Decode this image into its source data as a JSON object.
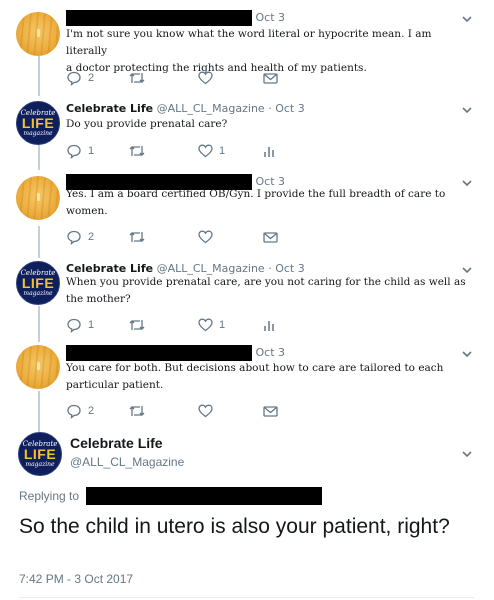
{
  "tweets": [
    {
      "author_name": "",
      "date": "Oct 3",
      "text_lines": [
        "I'm not sure you know what the word literal or hypocrite mean. I am literally",
        "a doctor protecting the rights and health of my patients."
      ],
      "replies": "2",
      "retweets": "",
      "likes": "",
      "last_action": "mail-icon"
    },
    {
      "author_name": "Celebrate Life",
      "handle": "@ALL_CL_Magazine",
      "separator": "·",
      "date": "Oct 3",
      "text_lines": [
        "Do you provide prenatal care?"
      ],
      "replies": "1",
      "retweets": "",
      "likes": "1",
      "last_action": "analytics-icon"
    },
    {
      "author_name": "",
      "date": "Oct 3",
      "text_lines": [
        "Yes. I am a board certified OB/Gyn. I provide the full breadth of care to",
        "women."
      ],
      "replies": "2",
      "retweets": "",
      "likes": "",
      "last_action": "mail-icon"
    },
    {
      "author_name": "Celebrate Life",
      "handle": "@ALL_CL_Magazine",
      "separator": "·",
      "date": "Oct 3",
      "text_lines": [
        "When you provide prenatal care, are you not caring for the child as well as",
        "the mother?"
      ],
      "replies": "1",
      "retweets": "",
      "likes": "1",
      "last_action": "analytics-icon"
    },
    {
      "author_name": "",
      "date": "Oct 3",
      "text_lines": [
        "You care for both. But decisions about how to care are tailored to each",
        "particular patient."
      ],
      "replies": "2",
      "retweets": "",
      "likes": "",
      "last_action": "mail-icon"
    }
  ],
  "main_tweet": {
    "author_name": "Celebrate Life",
    "handle": "@ALL_CL_Magazine",
    "replying_to_label": "Replying to",
    "text": "So the child in utero is also your patient, right?",
    "timestamp": "7:42 PM - 3 Oct 2017"
  },
  "avatar_logo": {
    "line1": "Celebrate",
    "line2": "LIFE",
    "line3": "magazine"
  },
  "colors": {
    "secondary_text": "#657786",
    "thread_line": "#c4cfd6",
    "logo_navy": "#0f1f5c",
    "logo_gold": "#f2c230",
    "redaction": "#000000"
  }
}
